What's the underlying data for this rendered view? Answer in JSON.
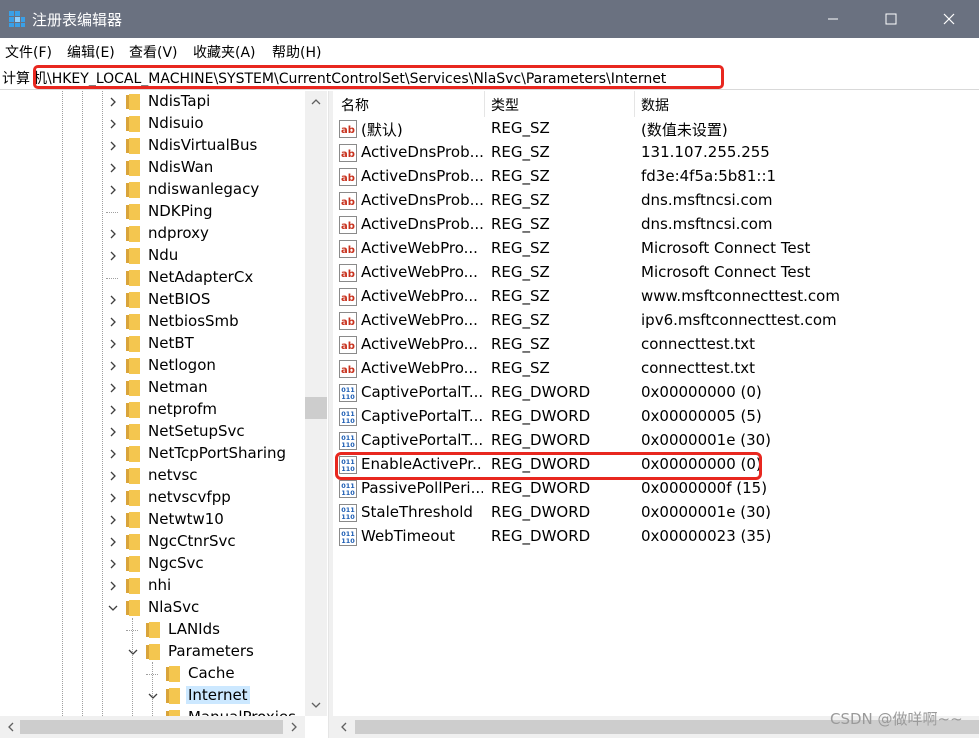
{
  "window": {
    "title": "注册表编辑器",
    "controls": {
      "minimize": "minimize-icon",
      "maximize": "maximize-icon",
      "close": "close-icon"
    }
  },
  "menu": [
    "文件(F)",
    "编辑(E)",
    "查看(V)",
    "收藏夹(A)",
    "帮助(H)"
  ],
  "address": {
    "prefix": "计算",
    "path": "机\\HKEY_LOCAL_MACHINE\\SYSTEM\\CurrentControlSet\\Services\\NlaSvc\\Parameters\\Internet",
    "highlight_color": "#e8271f"
  },
  "tree": {
    "items": [
      {
        "label": "NdisTapi",
        "expander": "collapsed"
      },
      {
        "label": "Ndisuio",
        "expander": "collapsed"
      },
      {
        "label": "NdisVirtualBus",
        "expander": "collapsed"
      },
      {
        "label": "NdisWan",
        "expander": "collapsed"
      },
      {
        "label": "ndiswanlegacy",
        "expander": "collapsed"
      },
      {
        "label": "NDKPing",
        "expander": "none"
      },
      {
        "label": "ndproxy",
        "expander": "collapsed"
      },
      {
        "label": "Ndu",
        "expander": "collapsed"
      },
      {
        "label": "NetAdapterCx",
        "expander": "none"
      },
      {
        "label": "NetBIOS",
        "expander": "collapsed"
      },
      {
        "label": "NetbiosSmb",
        "expander": "collapsed"
      },
      {
        "label": "NetBT",
        "expander": "collapsed"
      },
      {
        "label": "Netlogon",
        "expander": "collapsed"
      },
      {
        "label": "Netman",
        "expander": "collapsed"
      },
      {
        "label": "netprofm",
        "expander": "collapsed"
      },
      {
        "label": "NetSetupSvc",
        "expander": "collapsed"
      },
      {
        "label": "NetTcpPortSharing",
        "expander": "collapsed"
      },
      {
        "label": "netvsc",
        "expander": "collapsed"
      },
      {
        "label": "netvscvfpp",
        "expander": "collapsed"
      },
      {
        "label": "Netwtw10",
        "expander": "collapsed"
      },
      {
        "label": "NgcCtnrSvc",
        "expander": "collapsed"
      },
      {
        "label": "NgcSvc",
        "expander": "collapsed"
      },
      {
        "label": "nhi",
        "expander": "collapsed"
      },
      {
        "label": "NlaSvc",
        "expander": "expanded"
      },
      {
        "label": "LANIds",
        "expander": "none"
      },
      {
        "label": "Parameters",
        "expander": "expanded"
      },
      {
        "label": "Cache",
        "expander": "none"
      },
      {
        "label": "Internet",
        "expander": "expanded",
        "selected": true
      },
      {
        "label": "ManualProxies",
        "expander": "none"
      }
    ],
    "selected_bg": "#cce8ff"
  },
  "columns": {
    "name": "名称",
    "type": "类型",
    "data": "数据"
  },
  "values": [
    {
      "icon": "string-value-icon",
      "name": "(默认)",
      "type": "REG_SZ",
      "data": "(数值未设置)"
    },
    {
      "icon": "string-value-icon",
      "name": "ActiveDnsProb...",
      "type": "REG_SZ",
      "data": "131.107.255.255"
    },
    {
      "icon": "string-value-icon",
      "name": "ActiveDnsProb...",
      "type": "REG_SZ",
      "data": "fd3e:4f5a:5b81::1"
    },
    {
      "icon": "string-value-icon",
      "name": "ActiveDnsProb...",
      "type": "REG_SZ",
      "data": "dns.msftncsi.com"
    },
    {
      "icon": "string-value-icon",
      "name": "ActiveDnsProb...",
      "type": "REG_SZ",
      "data": "dns.msftncsi.com"
    },
    {
      "icon": "string-value-icon",
      "name": "ActiveWebPro...",
      "type": "REG_SZ",
      "data": "Microsoft Connect Test"
    },
    {
      "icon": "string-value-icon",
      "name": "ActiveWebPro...",
      "type": "REG_SZ",
      "data": "Microsoft Connect Test"
    },
    {
      "icon": "string-value-icon",
      "name": "ActiveWebPro...",
      "type": "REG_SZ",
      "data": "www.msftconnecttest.com"
    },
    {
      "icon": "string-value-icon",
      "name": "ActiveWebPro...",
      "type": "REG_SZ",
      "data": "ipv6.msftconnecttest.com"
    },
    {
      "icon": "string-value-icon",
      "name": "ActiveWebPro...",
      "type": "REG_SZ",
      "data": "connecttest.txt"
    },
    {
      "icon": "string-value-icon",
      "name": "ActiveWebPro...",
      "type": "REG_SZ",
      "data": "connecttest.txt"
    },
    {
      "icon": "dword-value-icon",
      "name": "CaptivePortalT...",
      "type": "REG_DWORD",
      "data": "0x00000000 (0)"
    },
    {
      "icon": "dword-value-icon",
      "name": "CaptivePortalT...",
      "type": "REG_DWORD",
      "data": "0x00000005 (5)"
    },
    {
      "icon": "dword-value-icon",
      "name": "CaptivePortalT...",
      "type": "REG_DWORD",
      "data": "0x0000001e (30)"
    },
    {
      "icon": "dword-value-icon",
      "name": "EnableActivePr...",
      "type": "REG_DWORD",
      "data": "0x00000000 (0)",
      "highlighted": true
    },
    {
      "icon": "dword-value-icon",
      "name": "PassivePollPeri...",
      "type": "REG_DWORD",
      "data": "0x0000000f (15)"
    },
    {
      "icon": "dword-value-icon",
      "name": "StaleThreshold",
      "type": "REG_DWORD",
      "data": "0x0000001e (30)"
    },
    {
      "icon": "dword-value-icon",
      "name": "WebTimeout",
      "type": "REG_DWORD",
      "data": "0x00000023 (35)"
    }
  ],
  "watermark": "CSDN @做咩啊~~",
  "colors": {
    "titlebar": "#6a7180",
    "highlight_border": "#e8271f",
    "selection": "#cce8ff",
    "folder": "#f4c64f"
  }
}
